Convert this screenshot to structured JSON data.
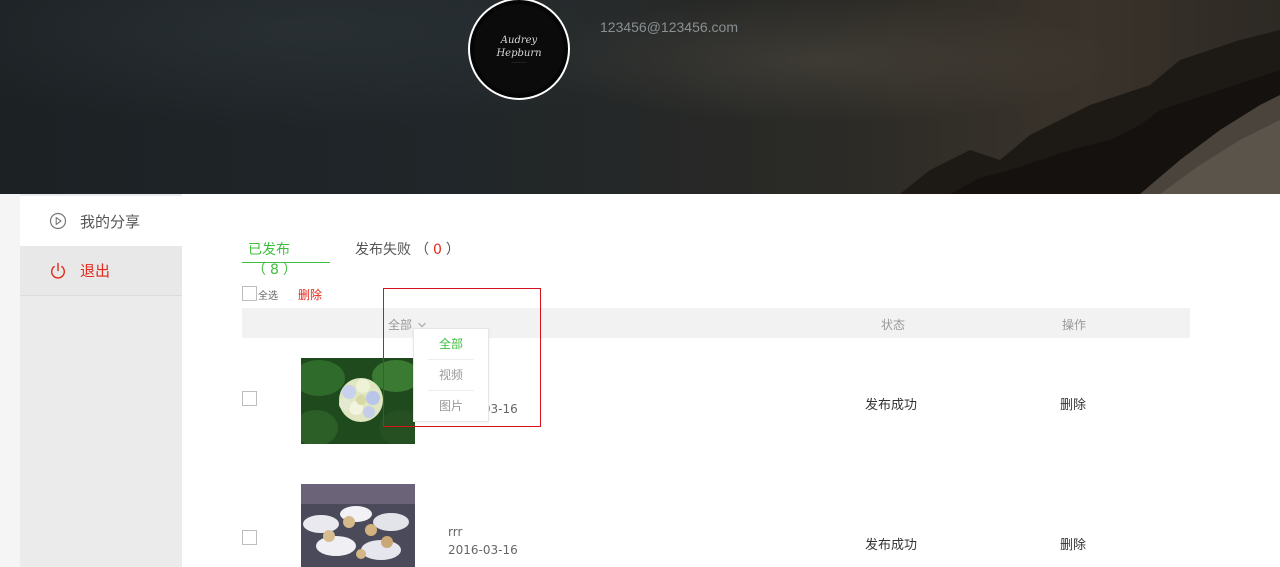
{
  "header": {
    "avatar_lines": [
      "Audrey",
      "Hepburn"
    ],
    "email": "123456@123456.com"
  },
  "sidebar": {
    "items": [
      {
        "label": "我的分享",
        "icon": "play-circle-icon"
      },
      {
        "label": "退出",
        "icon": "power-icon"
      }
    ]
  },
  "tabs": {
    "published_label": "已发布",
    "published_count": "8",
    "failed_label": "发布失败",
    "failed_count": "0",
    "open_paren": "（",
    "close_paren": "）"
  },
  "toolbar": {
    "select_all_label": "全选",
    "delete_label": "删除"
  },
  "table": {
    "headers": {
      "filter": "全部",
      "status": "状态",
      "action": "操作"
    },
    "rows": [
      {
        "title": "",
        "date": "2016-03-16",
        "status": "发布成功",
        "action": "删除"
      },
      {
        "title": "rrr",
        "date": "2016-03-16",
        "status": "发布成功",
        "action": "删除"
      }
    ]
  },
  "dropdown": {
    "options": [
      "全部",
      "视频",
      "图片"
    ],
    "selected": "全部"
  },
  "colors": {
    "accent_green": "#3fbf3f",
    "danger_red": "#e3291b"
  }
}
